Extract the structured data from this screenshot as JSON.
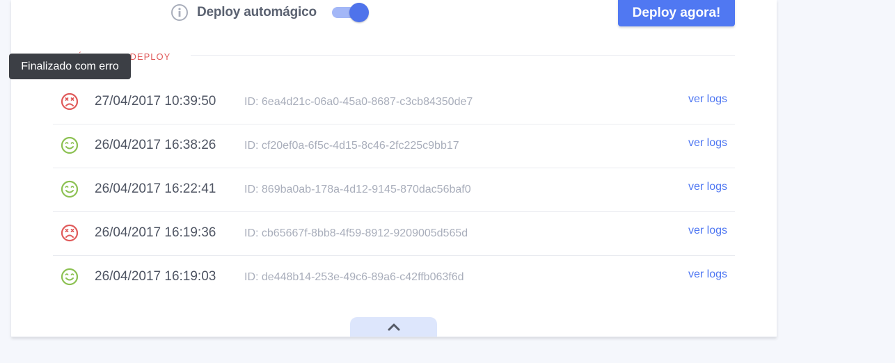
{
  "header": {
    "auto_deploy_label": "Deploy automágico",
    "auto_deploy_enabled": true,
    "deploy_button_label": "Deploy agora!"
  },
  "history": {
    "title": "Histórico de deploy",
    "tooltip": "Finalizado com erro",
    "rows": [
      {
        "status": "error",
        "datetime": "27/04/2017 10:39:50",
        "id": "ID: 6ea4d21c-06a0-45a0-8687-c3cb84350de7",
        "logs_label": "ver logs"
      },
      {
        "status": "success",
        "datetime": "26/04/2017 16:38:26",
        "id": "ID: cf20ef0a-6f5c-4d15-8c46-2fc225c9bb17",
        "logs_label": "ver logs"
      },
      {
        "status": "success",
        "datetime": "26/04/2017 16:22:41",
        "id": "ID: 869ba0ab-178a-4d12-9145-870dac56baf0",
        "logs_label": "ver logs"
      },
      {
        "status": "error",
        "datetime": "26/04/2017 16:19:36",
        "id": "ID: cb65667f-8bb8-4f59-8912-9209005d565d",
        "logs_label": "ver logs"
      },
      {
        "status": "success",
        "datetime": "26/04/2017 16:19:03",
        "id": "ID: de448b14-253e-49c6-89a6-c42ffb063f6d",
        "logs_label": "ver logs"
      }
    ]
  },
  "colors": {
    "accent": "#5078f2",
    "error": "#e05a5a",
    "success": "#8cc152"
  },
  "icons": {
    "info": "info-icon",
    "error": "sad-face-icon",
    "success": "happy-face-icon",
    "collapse": "chevron-up-icon"
  }
}
